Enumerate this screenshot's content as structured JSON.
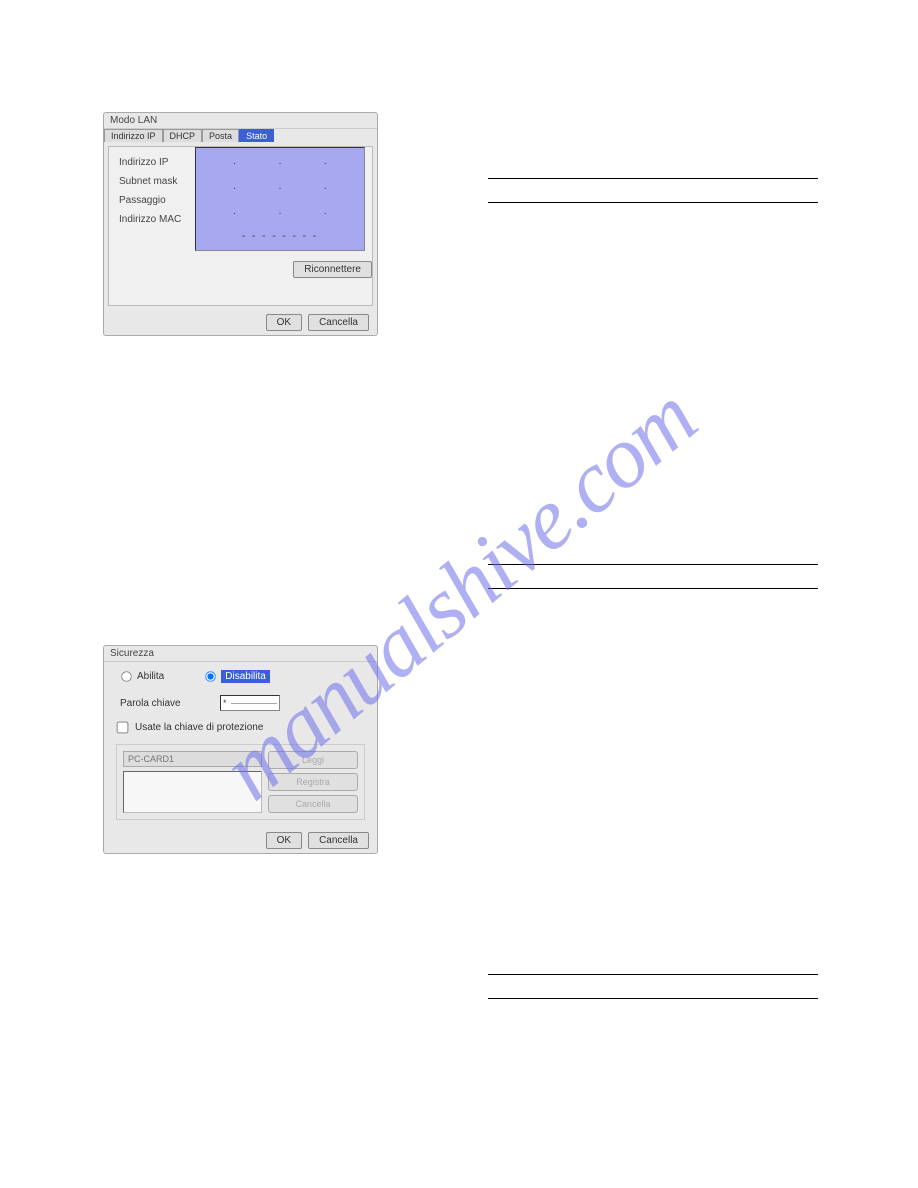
{
  "watermark": "manualshive.com",
  "dialog1": {
    "title": "Modo LAN",
    "tabs": {
      "ip": "Indirizzo IP",
      "dhcp": "DHCP",
      "posta": "Posta",
      "stato": "Stato"
    },
    "labels": {
      "ip": "Indirizzo IP",
      "subnet": "Subnet mask",
      "gateway": "Passaggio",
      "mac": "Indirizzo MAC"
    },
    "ip_values": {
      "row1": [
        ".",
        ".",
        "."
      ],
      "row2": [
        ".",
        ".",
        "."
      ],
      "row3": [
        ".",
        ".",
        "."
      ],
      "mac": "- - - - - - - -"
    },
    "reconnect": "Riconnettere",
    "ok": "OK",
    "cancel": "Cancella"
  },
  "dialog2": {
    "title": "Sicurezza",
    "enable": "Abilita",
    "disable": "Disabilita",
    "password_label": "Parola chiave",
    "password_value": "*",
    "checkbox": "Usate la chiave di protezione",
    "key_placeholder": "PC-CARD1",
    "read": "Leggi",
    "register": "Registra",
    "delete": "Cancella",
    "ok": "OK",
    "cancel": "Cancella"
  }
}
